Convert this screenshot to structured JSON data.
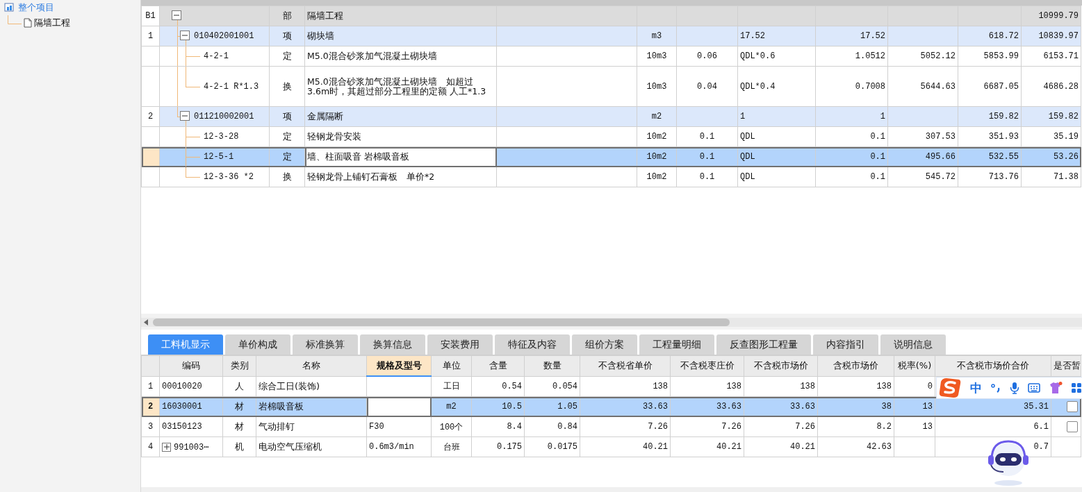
{
  "sidebar": {
    "items": [
      {
        "label": "整个项目",
        "selected": true,
        "children": [
          {
            "label": "隔墙工程",
            "selected": false
          }
        ]
      }
    ]
  },
  "table": {
    "rows": [
      {
        "kind": "section",
        "num": "B1",
        "type": "部",
        "name": "隔墙工程",
        "column_12": "10999.79",
        "selected": false,
        "expanded": true,
        "children": [
          {
            "kind": "item",
            "num": "1",
            "code": "010402001001",
            "type": "项",
            "name": "砌块墙",
            "unit": "m3",
            "column_8": "17.52",
            "column_9": "17.52",
            "column_11": "618.72",
            "column_12": "10839.97",
            "selected": false,
            "expanded": true,
            "children": [
              {
                "kind": "quota",
                "code": "4-2-1",
                "type": "定",
                "name": "M5.0混合砂浆加气混凝土砌块墙",
                "unit": "10m3",
                "column_7": "0.06",
                "column_8": "QDL*0.6",
                "column_9": "1.0512",
                "column_10": "5052.12",
                "column_11": "5853.99",
                "column_12": "6153.71",
                "selected": false
              },
              {
                "kind": "quota",
                "code": "4-2-1 R*1.3",
                "type": "换",
                "name": "M5.0混合砂浆加气混凝土砌块墙　如超过3.6m时，其超过部分工程里的定额 人工*1.3",
                "unit": "10m3",
                "column_7": "0.04",
                "column_8": "QDL*0.4",
                "column_9": "0.7008",
                "column_10": "5644.63",
                "column_11": "6687.05",
                "column_12": "4686.28",
                "selected": false
              }
            ]
          },
          {
            "kind": "item",
            "num": "2",
            "code": "011210002001",
            "type": "项",
            "name": "金属隔断",
            "unit": "m2",
            "column_8": "1",
            "column_9": "1",
            "column_11": "159.82",
            "column_12": "159.82",
            "selected": false,
            "expanded": true,
            "children": [
              {
                "kind": "quota",
                "code": "12-3-28",
                "type": "定",
                "name": "轻钢龙骨安装",
                "unit": "10m2",
                "column_7": "0.1",
                "column_8": "QDL",
                "column_9": "0.1",
                "column_10": "307.53",
                "column_11": "351.93",
                "column_12": "35.19",
                "selected": false
              },
              {
                "kind": "quota",
                "code": "12-5-1",
                "type": "定",
                "name": "墙、柱面吸音 岩棉吸音板",
                "unit": "10m2",
                "column_7": "0.1",
                "column_8": "QDL",
                "column_9": "0.1",
                "column_10": "495.66",
                "column_11": "532.55",
                "column_12": "53.26",
                "selected": true
              },
              {
                "kind": "quota",
                "code": "12-3-36 *2",
                "type": "换",
                "name": "轻钢龙骨上铺钉石膏板　单价*2",
                "unit": "10m2",
                "column_7": "0.1",
                "column_8": "QDL",
                "column_9": "0.1",
                "column_10": "545.72",
                "column_11": "713.76",
                "column_12": "71.38",
                "selected": false
              }
            ]
          }
        ]
      }
    ]
  },
  "tabs": [
    {
      "label": "工料机显示",
      "selected": true
    },
    {
      "label": "单价构成",
      "selected": false
    },
    {
      "label": "标准换算",
      "selected": false
    },
    {
      "label": "换算信息",
      "selected": false
    },
    {
      "label": "安装费用",
      "selected": false
    },
    {
      "label": "特征及内容",
      "selected": false
    },
    {
      "label": "组价方案",
      "selected": false
    },
    {
      "label": "工程量明细",
      "selected": false
    },
    {
      "label": "反查图形工程量",
      "selected": false
    },
    {
      "label": "内容指引",
      "selected": false
    },
    {
      "label": "说明信息",
      "selected": false
    }
  ],
  "resources": {
    "columns": [
      {
        "label": "编码",
        "selected": false
      },
      {
        "label": "类别",
        "selected": false
      },
      {
        "label": "名称",
        "selected": false
      },
      {
        "label": "规格及型号",
        "selected": true
      },
      {
        "label": "单位",
        "selected": false
      },
      {
        "label": "含量",
        "selected": false
      },
      {
        "label": "数量",
        "selected": false
      },
      {
        "label": "不含税省单价",
        "selected": false
      },
      {
        "label": "不含税枣庄价",
        "selected": false
      },
      {
        "label": "不含税市场价",
        "selected": false
      },
      {
        "label": "含税市场价",
        "selected": false
      },
      {
        "label": "税率(%)",
        "selected": false
      },
      {
        "label": "不含税市场价合价",
        "selected": false
      },
      {
        "label": "是否暂",
        "selected": false
      }
    ],
    "rows": [
      {
        "num": "1",
        "code": "00010020",
        "category": "人",
        "name": "综合工日(装饰)",
        "unit": "工日",
        "content": "0.54",
        "quantity": "0.054",
        "province_price": "138",
        "zaozhuang_price": "138",
        "market_price": "138",
        "market_price_tax": "138",
        "tax_rate": "0",
        "selected": false
      },
      {
        "num": "2",
        "code": "16030001",
        "category": "材",
        "name": "岩棉吸音板",
        "unit": "m2",
        "content": "10.5",
        "quantity": "1.05",
        "province_price": "33.63",
        "zaozhuang_price": "33.63",
        "market_price": "33.63",
        "market_price_tax": "38",
        "tax_rate": "13",
        "total": "35.31",
        "checked": false,
        "selected": true
      },
      {
        "num": "3",
        "code": "03150123",
        "category": "材",
        "name": "气动排钉",
        "spec": "F30",
        "unit": "100个",
        "content": "8.4",
        "quantity": "0.84",
        "province_price": "7.26",
        "zaozhuang_price": "7.26",
        "market_price": "7.26",
        "market_price_tax": "8.2",
        "tax_rate": "13",
        "total": "6.1",
        "checked": false,
        "selected": false
      },
      {
        "num": "4",
        "code": "991003⋯",
        "expanded": false,
        "category": "机",
        "name": "电动空气压缩机",
        "spec": "0.6m3/min",
        "unit": "台班",
        "content": "0.175",
        "quantity": "0.0175",
        "province_price": "40.21",
        "zaozhuang_price": "40.21",
        "market_price": "40.21",
        "market_price_tax": "42.63",
        "total": "0.7",
        "selected": false
      }
    ]
  },
  "ime_toolbar": {
    "mode": "中"
  }
}
